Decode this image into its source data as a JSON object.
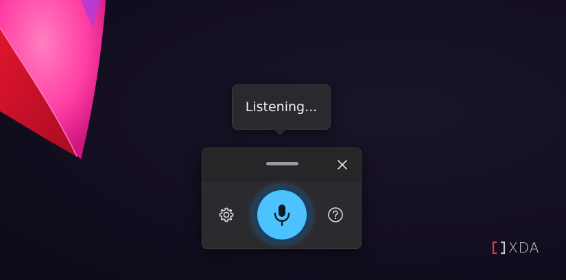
{
  "tooltip": {
    "text": "Listening..."
  },
  "voice_panel": {
    "close_icon": "close-icon",
    "settings_icon": "gear-icon",
    "help_icon": "question-circle-icon",
    "mic_icon": "microphone-icon",
    "mic_state": "listening"
  },
  "watermark": {
    "text": "XDA"
  },
  "colors": {
    "accent": "#4cc2ff",
    "panel_bg": "#2b2b2f",
    "desktop_bg": "#120d1e",
    "watermark_red": "#e8374a"
  }
}
